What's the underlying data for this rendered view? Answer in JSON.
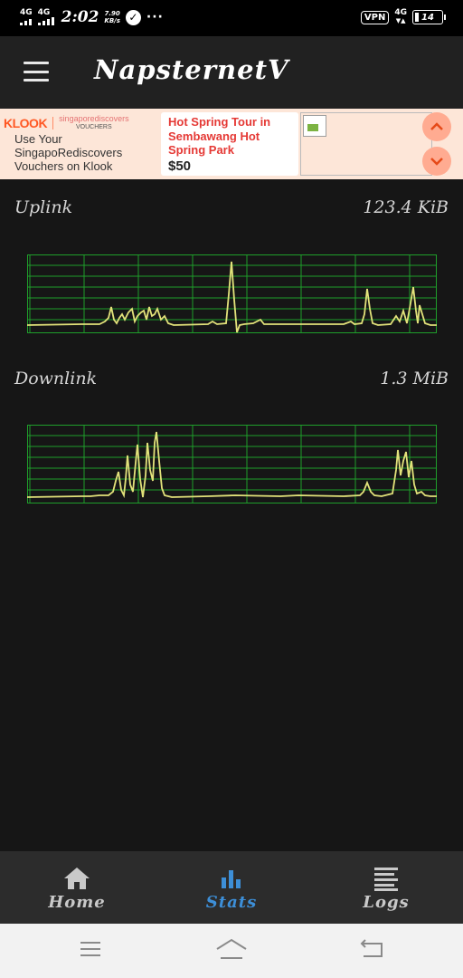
{
  "status_bar": {
    "net1": "4G",
    "net2": "4G",
    "time": "2:02",
    "speed_value": "7.90",
    "speed_unit": "KB/s",
    "more": "···",
    "vpn": "VPN",
    "net_right": "4G",
    "battery": "14",
    "check_icon": "check-circle-icon"
  },
  "app_bar": {
    "title": "NapsternetV",
    "menu_icon": "hamburger-menu-icon"
  },
  "ad": {
    "brand": "KLOOK",
    "partner": "singaporediscovers",
    "partner_sub": "VOUCHERS",
    "left_text": "Use Your SingapoRediscovers Vouchers on Klook",
    "offer_title": "Hot Spring Tour in Sembawang Hot Spring Park",
    "offer_price": "$50",
    "up_icon": "chevron-up-icon",
    "down_icon": "chevron-down-icon",
    "image_icon": "broken-image-icon",
    "accent": "#ff5722"
  },
  "stats": {
    "uplink": {
      "label": "Uplink",
      "value": "123.4 KiB"
    },
    "downlink": {
      "label": "Downlink",
      "value": "1.3 MiB"
    },
    "graph_line_color": "#e2e27a",
    "grid_color": "#1f9e2b"
  },
  "nav": {
    "items": [
      {
        "label": "Home",
        "icon": "home-icon"
      },
      {
        "label": "Stats",
        "icon": "bar-chart-icon"
      },
      {
        "label": "Logs",
        "icon": "logs-icon"
      }
    ],
    "active_color": "#3d8fd8"
  },
  "system_nav": {
    "menu_icon": "menu-icon",
    "home_icon": "home-outline-icon",
    "back_icon": "back-icon"
  }
}
